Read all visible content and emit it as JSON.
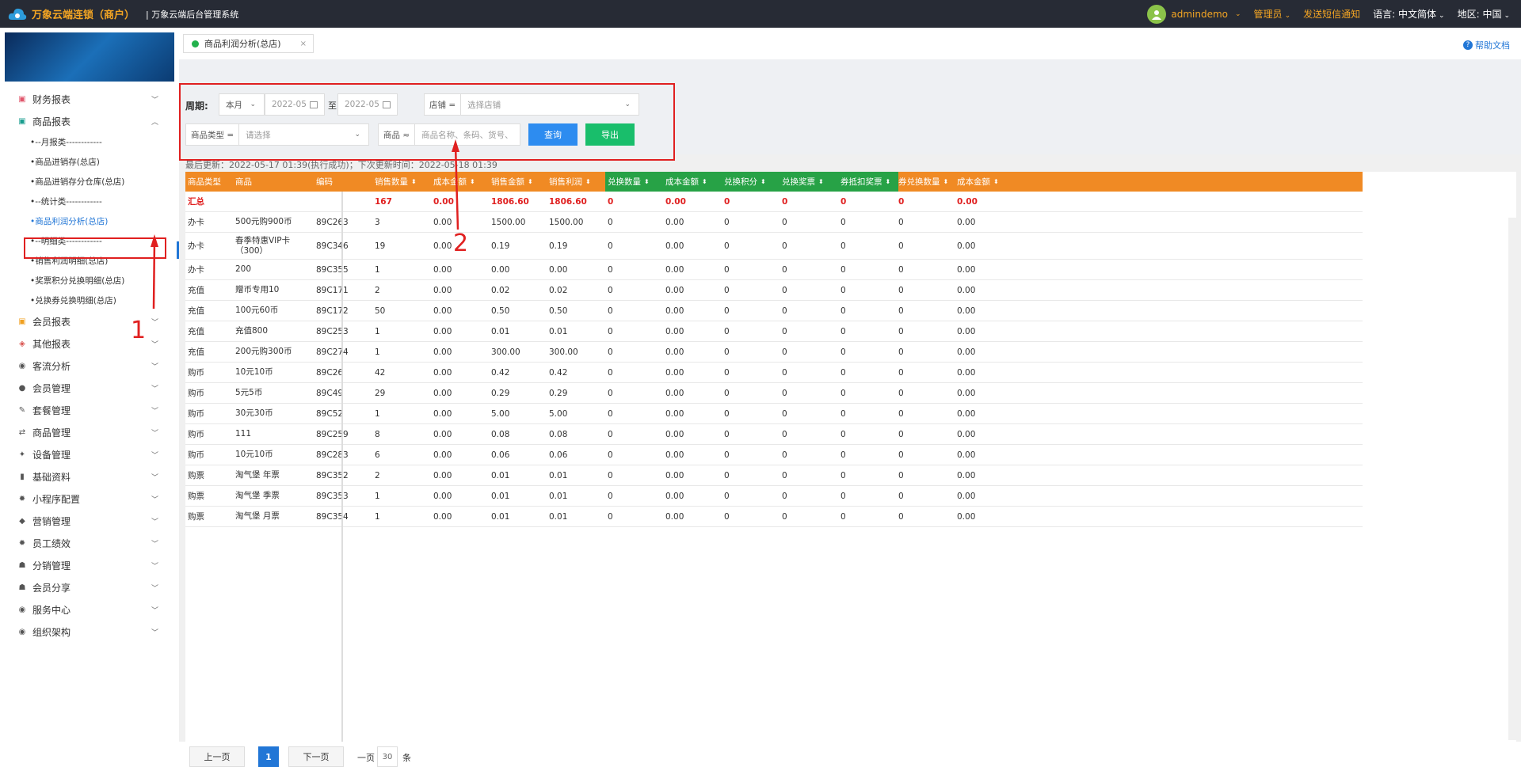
{
  "topbar": {
    "brand": "万象云端连锁（商户）",
    "subtitle": "| 万象云端后台管理系统",
    "user": "admindemo",
    "role": "管理员",
    "sms": "发送短信通知",
    "lang_label": "语言:",
    "lang": "中文简体",
    "region_label": "地区:",
    "region": "中国"
  },
  "sidebar": {
    "items": [
      {
        "label": "财务报表",
        "icon": "finance-icon",
        "glyph": "▣",
        "color": "#e0556b"
      },
      {
        "label": "商品报表",
        "icon": "goods-report-icon",
        "glyph": "▣",
        "color": "#1a9e8f"
      }
    ],
    "subitems": [
      "--月报类------------",
      "商品进销存(总店)",
      "商品进销存分仓库(总店)",
      "--统计类------------",
      "商品利润分析(总店)",
      "--明细类------------",
      "销售利润明细(总店)",
      "奖票积分兑换明细(总店)",
      "兑换券兑换明细(总店)"
    ],
    "rest": [
      {
        "label": "会员报表",
        "icon": "member-report-icon",
        "glyph": "▣",
        "color": "#f0a020"
      },
      {
        "label": "其他报表",
        "icon": "layers-icon",
        "glyph": "◈",
        "color": "#d9534f"
      },
      {
        "label": "客流分析",
        "icon": "target-icon",
        "glyph": "◉",
        "color": "#555"
      },
      {
        "label": "会员管理",
        "icon": "user-icon",
        "glyph": "●",
        "color": "#555"
      },
      {
        "label": "套餐管理",
        "icon": "edit-icon",
        "glyph": "✎",
        "color": "#555"
      },
      {
        "label": "商品管理",
        "icon": "swap-icon",
        "glyph": "⇄",
        "color": "#555"
      },
      {
        "label": "设备管理",
        "icon": "tool-icon",
        "glyph": "✦",
        "color": "#555"
      },
      {
        "label": "基础资料",
        "icon": "doc-icon",
        "glyph": "▮",
        "color": "#555"
      },
      {
        "label": "小程序配置",
        "icon": "gear-icon",
        "glyph": "✹",
        "color": "#555"
      },
      {
        "label": "营销管理",
        "icon": "tag-icon",
        "glyph": "◆",
        "color": "#555"
      },
      {
        "label": "员工绩效",
        "icon": "cog-icon",
        "glyph": "✹",
        "color": "#555"
      },
      {
        "label": "分销管理",
        "icon": "users-icon",
        "glyph": "☗",
        "color": "#555"
      },
      {
        "label": "会员分享",
        "icon": "share-icon",
        "glyph": "☗",
        "color": "#555"
      },
      {
        "label": "服务中心",
        "icon": "service-icon",
        "glyph": "◉",
        "color": "#555"
      },
      {
        "label": "组织架构",
        "icon": "org-icon",
        "glyph": "◉",
        "color": "#555"
      }
    ]
  },
  "tab": {
    "label": "商品利润分析(总店)",
    "close": "×"
  },
  "help": "帮助文档",
  "filter": {
    "period_label": "周期:",
    "period": "本月",
    "date_from": "2022-05",
    "to": "至",
    "date_to": "2022-05",
    "store_prefix": "店铺 =",
    "store_placeholder": "选择店铺",
    "type_prefix": "商品类型 =",
    "type_placeholder": "请选择",
    "goods_prefix": "商品 ≈",
    "goods_placeholder": "商品名称、条码、货号、",
    "query": "查询",
    "export": "导出"
  },
  "update_text": "最后更新：2022-05-17 01:39(执行成功)；下次更新时间：2022-05-18 01:39",
  "table": {
    "headers": [
      "商品类型",
      "商品",
      "编码",
      "销售数量",
      "成本金额",
      "销售金额",
      "销售利润",
      "兑换数量",
      "成本金额",
      "兑换积分",
      "兑换奖票",
      "券抵扣奖票",
      "券兑换数量",
      "成本金额"
    ],
    "total": [
      "汇总",
      "",
      "",
      "167",
      "0.00",
      "1806.60",
      "1806.60",
      "0",
      "0.00",
      "0",
      "0",
      "0",
      "0",
      "0.00"
    ],
    "rows": [
      [
        "办卡",
        "500元购900币",
        "89C263",
        "3",
        "0.00",
        "1500.00",
        "1500.00",
        "0",
        "0.00",
        "0",
        "0",
        "0",
        "0",
        "0.00"
      ],
      [
        "办卡",
        "春季特惠VIP卡（300）",
        "89C346",
        "19",
        "0.00",
        "0.19",
        "0.19",
        "0",
        "0.00",
        "0",
        "0",
        "0",
        "0",
        "0.00"
      ],
      [
        "办卡",
        "200",
        "89C355",
        "1",
        "0.00",
        "0.00",
        "0.00",
        "0",
        "0.00",
        "0",
        "0",
        "0",
        "0",
        "0.00"
      ],
      [
        "充值",
        "赠币专用10",
        "89C171",
        "2",
        "0.00",
        "0.02",
        "0.02",
        "0",
        "0.00",
        "0",
        "0",
        "0",
        "0",
        "0.00"
      ],
      [
        "充值",
        "100元60币",
        "89C172",
        "50",
        "0.00",
        "0.50",
        "0.50",
        "0",
        "0.00",
        "0",
        "0",
        "0",
        "0",
        "0.00"
      ],
      [
        "充值",
        "充值800",
        "89C253",
        "1",
        "0.00",
        "0.01",
        "0.01",
        "0",
        "0.00",
        "0",
        "0",
        "0",
        "0",
        "0.00"
      ],
      [
        "充值",
        "200元购300币",
        "89C274",
        "1",
        "0.00",
        "300.00",
        "300.00",
        "0",
        "0.00",
        "0",
        "0",
        "0",
        "0",
        "0.00"
      ],
      [
        "购币",
        "10元10币",
        "89C26",
        "42",
        "0.00",
        "0.42",
        "0.42",
        "0",
        "0.00",
        "0",
        "0",
        "0",
        "0",
        "0.00"
      ],
      [
        "购币",
        "5元5币",
        "89C49",
        "29",
        "0.00",
        "0.29",
        "0.29",
        "0",
        "0.00",
        "0",
        "0",
        "0",
        "0",
        "0.00"
      ],
      [
        "购币",
        "30元30币",
        "89C52",
        "1",
        "0.00",
        "5.00",
        "5.00",
        "0",
        "0.00",
        "0",
        "0",
        "0",
        "0",
        "0.00"
      ],
      [
        "购币",
        "111",
        "89C259",
        "8",
        "0.00",
        "0.08",
        "0.08",
        "0",
        "0.00",
        "0",
        "0",
        "0",
        "0",
        "0.00"
      ],
      [
        "购币",
        "10元10币",
        "89C283",
        "6",
        "0.00",
        "0.06",
        "0.06",
        "0",
        "0.00",
        "0",
        "0",
        "0",
        "0",
        "0.00"
      ],
      [
        "购票",
        "淘气堡 年票",
        "89C352",
        "2",
        "0.00",
        "0.01",
        "0.01",
        "0",
        "0.00",
        "0",
        "0",
        "0",
        "0",
        "0.00"
      ],
      [
        "购票",
        "淘气堡 季票",
        "89C353",
        "1",
        "0.00",
        "0.01",
        "0.01",
        "0",
        "0.00",
        "0",
        "0",
        "0",
        "0",
        "0.00"
      ],
      [
        "购票",
        "淘气堡 月票",
        "89C354",
        "1",
        "0.00",
        "0.01",
        "0.01",
        "0",
        "0.00",
        "0",
        "0",
        "0",
        "0",
        "0.00"
      ]
    ]
  },
  "pager": {
    "prev": "上一页",
    "page": "1",
    "next": "下一页",
    "per_label": "一页",
    "per_value": "30",
    "per_unit": "条"
  },
  "annotations": {
    "one": "1",
    "two": "2"
  },
  "colors": {
    "header_orange": "#f08a24",
    "header_green": "#27a246",
    "accent": "#2176d6",
    "total_red": "#e02020"
  }
}
